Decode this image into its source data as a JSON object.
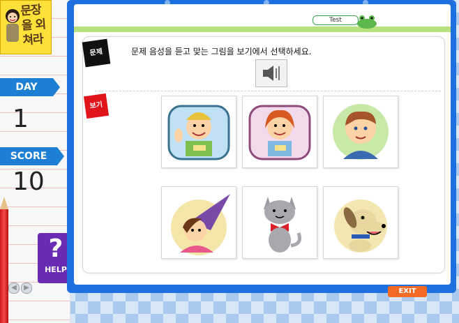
{
  "logo": {
    "title": "문장을 외쳐라"
  },
  "sidebar": {
    "day_label": "DAY",
    "day_value": "1",
    "score_label": "SCORE",
    "score_value": "10",
    "help_symbol": "?",
    "help_label": "HELP"
  },
  "header": {
    "tab_label": "Test"
  },
  "question": {
    "tag_label": "문제",
    "text": "문제 음성을 듣고 맞는 그림을 보기에서 선택하세요."
  },
  "choices": {
    "tag_label": "보기",
    "items": [
      {
        "icon": "boy-waving-icon"
      },
      {
        "icon": "girl-freckles-icon"
      },
      {
        "icon": "boy-face-icon"
      },
      {
        "icon": "witch-girl-icon"
      },
      {
        "icon": "cat-bowtie-icon"
      },
      {
        "icon": "dog-icon"
      }
    ]
  },
  "footer": {
    "exit_label": "EXIT"
  },
  "colors": {
    "board": "#1e6fe0",
    "ribbon": "#1d7fd4",
    "help": "#6a2bb4",
    "exit": "#f26a24"
  }
}
